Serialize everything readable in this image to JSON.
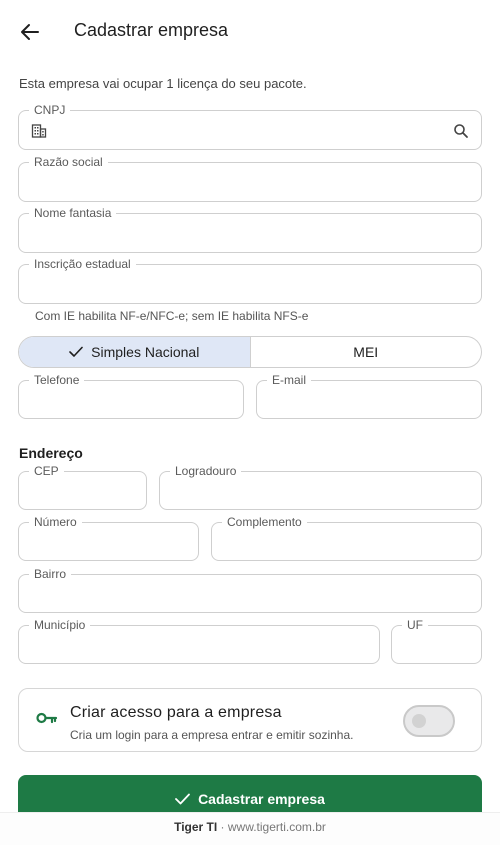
{
  "appbar": {
    "title": "Cadastrar empresa",
    "back_icon": "arrow-left-icon"
  },
  "info": "Esta empresa vai ocupar 1 licença do seu pacote.",
  "fields": {
    "cnpj": {
      "label": "CNPJ",
      "value": "",
      "prefix_icon": "building-icon",
      "suffix_icon": "search-icon"
    },
    "razao_social": {
      "label": "Razão social",
      "value": ""
    },
    "nome_fantasia": {
      "label": "Nome fantasia",
      "value": ""
    },
    "inscricao_estadual": {
      "label": "Inscrição estadual",
      "value": ""
    },
    "telefone": {
      "label": "Telefone",
      "value": ""
    },
    "email": {
      "label": "E-mail",
      "value": ""
    },
    "cep": {
      "label": "CEP",
      "value": ""
    },
    "logradouro": {
      "label": "Logradouro",
      "value": ""
    },
    "numero": {
      "label": "Número",
      "value": ""
    },
    "complemento": {
      "label": "Complemento",
      "value": ""
    },
    "bairro": {
      "label": "Bairro",
      "value": ""
    },
    "municipio": {
      "label": "Município",
      "value": ""
    },
    "uf": {
      "label": "UF",
      "value": ""
    }
  },
  "helper_ie": "Com IE habilita NF-e/NFC-e; sem IE habilita NFS-e",
  "regime": {
    "options": [
      "Simples Nacional",
      "MEI"
    ],
    "selected": "Simples Nacional"
  },
  "address_section": {
    "title": "Endereço"
  },
  "access_card": {
    "title": "Criar acesso para a empresa",
    "subtitle": "Cria um login para a empresa entrar e emitir sozinha.",
    "icon": "key-icon",
    "toggle_on": false
  },
  "submit": {
    "label": "Cadastrar empresa",
    "icon": "check-icon"
  },
  "footer": {
    "brand": "Tiger TI",
    "separator": "·",
    "site": "www.tigerti.com.br"
  },
  "colors": {
    "primary": "#1e7a45",
    "segment_selected": "#dfe7f6",
    "border": "#cfcfcf"
  }
}
